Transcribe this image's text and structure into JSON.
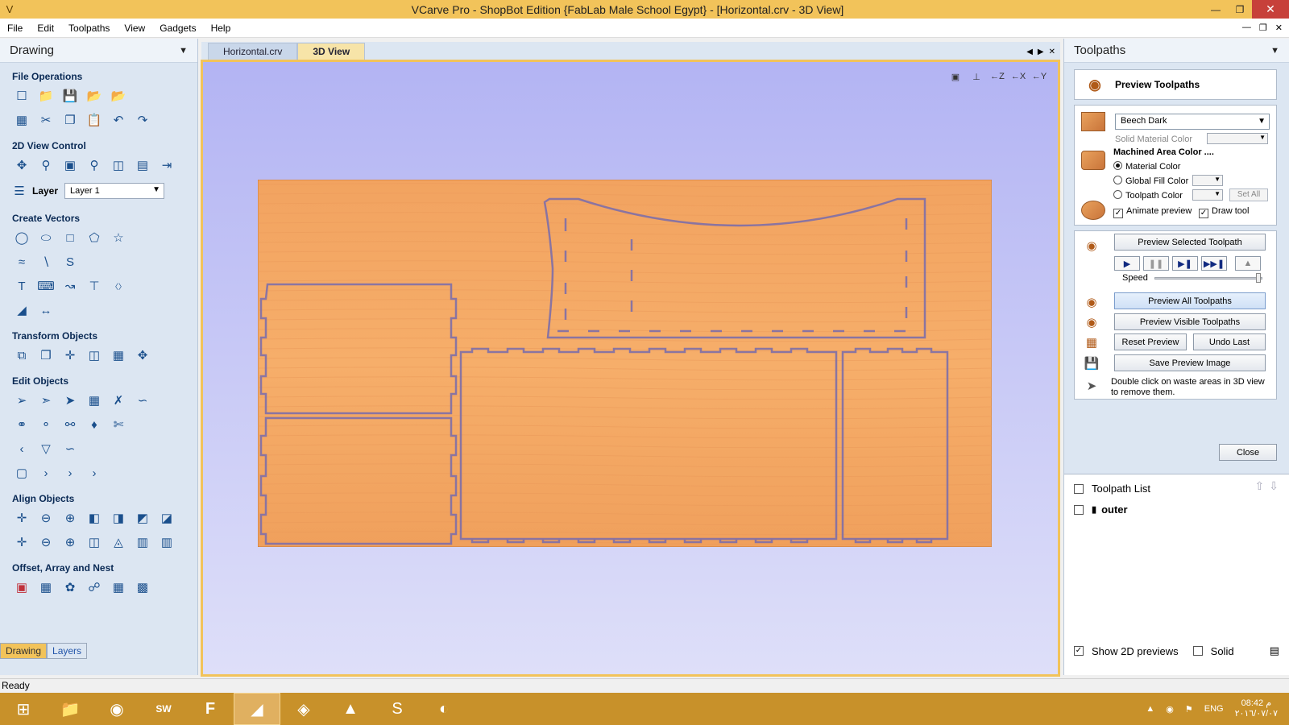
{
  "window": {
    "title": "VCarve Pro - ShopBot Edition {FabLab Male School Egypt} - [Horizontal.crv - 3D View]"
  },
  "menu": [
    "File",
    "Edit",
    "Toolpaths",
    "View",
    "Gadgets",
    "Help"
  ],
  "left_panel": {
    "title": "Drawing",
    "sections": {
      "file_operations": "File Operations",
      "view_control": "2D View Control",
      "create_vectors": "Create Vectors",
      "transform_objects": "Transform Objects",
      "edit_objects": "Edit Objects",
      "align_objects": "Align Objects",
      "offset_array_nest": "Offset, Array and Nest"
    },
    "layer_label": "Layer",
    "layer_value": "Layer 1",
    "tabs": [
      "Drawing",
      "Layers"
    ]
  },
  "doc_tabs": [
    "Horizontal.crv",
    "3D View"
  ],
  "right_panel": {
    "title": "Toolpaths",
    "preview_header": "Preview Toolpaths",
    "material": "Beech Dark",
    "solid_material_color": "Solid Material Color",
    "machined_area_color": "Machined Area Color ....",
    "radio_material_color": "Material Color",
    "radio_global_fill": "Global Fill Color",
    "radio_toolpath_color": "Toolpath Color",
    "set_all": "Set All",
    "animate_preview": "Animate preview",
    "draw_tool": "Draw tool",
    "preview_selected": "Preview Selected Toolpath",
    "speed": "Speed",
    "speed_level": 0.98,
    "preview_all": "Preview All Toolpaths",
    "preview_visible": "Preview Visible Toolpaths",
    "reset_preview": "Reset Preview",
    "undo_last": "Undo Last",
    "save_preview_image": "Save Preview Image",
    "note": "Double click on waste areas in 3D view to remove them.",
    "close": "Close",
    "toolpath_list": "Toolpath List",
    "toolpath_item": "outer",
    "show_2d_previews": "Show 2D previews",
    "solid": "Solid"
  },
  "status": "Ready",
  "tray": {
    "lang": "ENG",
    "time": "08:42 م",
    "date": "٢٠١٦/٠٧/٠٧"
  }
}
